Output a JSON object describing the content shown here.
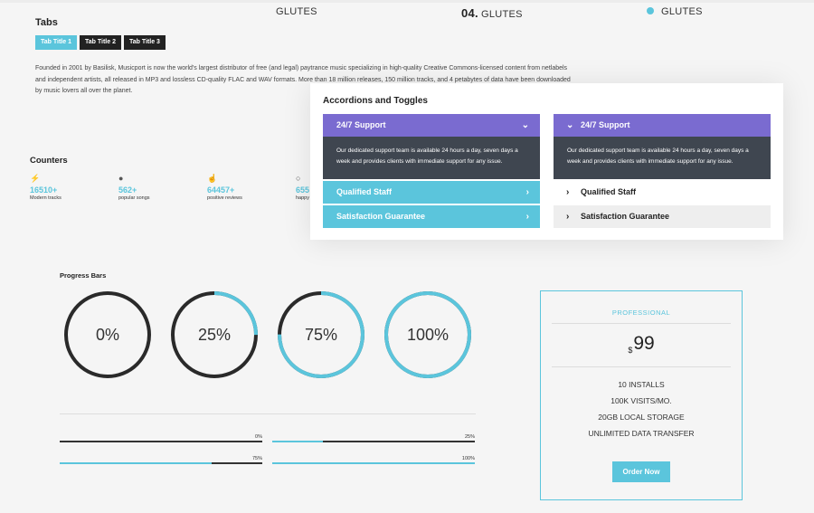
{
  "topnav": {
    "item1": "GLUTES",
    "item2_num": "04.",
    "item2": "GLUTES",
    "item3": "GLUTES"
  },
  "tabs": {
    "title": "Tabs",
    "items": [
      "Tab Title 1",
      "Tab Title 2",
      "Tab Title 3"
    ],
    "text": "Founded in 2001 by Basilisk, Musicport is now the world's largest distributor of free (and legal) paytrance music specializing in high-quality Creative Commons-licensed content from netlabels and independent artists, all released in MP3 and lossless CD-quality FLAC and WAV formats. More than 18 million releases, 150 million tracks, and 4 petabytes of data have been downloaded by music lovers all over the planet."
  },
  "counters": {
    "title": "Counters",
    "items": [
      {
        "icon": "bolt-icon",
        "value": "16510+",
        "label": "Modern tracks"
      },
      {
        "icon": "note-icon",
        "value": "562+",
        "label": "popular songs"
      },
      {
        "icon": "hand-icon",
        "value": "64457+",
        "label": "positive reviews"
      },
      {
        "icon": "bulb-icon",
        "value": "655",
        "label": "happy"
      }
    ]
  },
  "accordions": {
    "title": "Accordions and Toggles",
    "left": [
      {
        "label": "24/7 Support",
        "open": true,
        "body": "Our dedicated support team is available 24 hours a day, seven days a week and provides clients with immediate support for any issue."
      },
      {
        "label": "Qualified Staff",
        "open": false
      },
      {
        "label": "Satisfaction Guarantee",
        "open": false
      }
    ],
    "right": [
      {
        "label": "24/7 Support",
        "open": true,
        "body": "Our dedicated support team is available 24 hours a day, seven days a week and provides clients with immediate support for any issue."
      },
      {
        "label": "Qualified Staff",
        "open": false
      },
      {
        "label": "Satisfaction Guarantee",
        "open": false
      }
    ]
  },
  "progress": {
    "title": "Progress Bars",
    "circles": [
      {
        "label": "0%",
        "value": 0
      },
      {
        "label": "25%",
        "value": 25
      },
      {
        "label": "75%",
        "value": 75
      },
      {
        "label": "100%",
        "value": 100
      }
    ],
    "bars": [
      {
        "label": "0%",
        "value": 0
      },
      {
        "label": "25%",
        "value": 25
      },
      {
        "label": "75%",
        "value": 75
      },
      {
        "label": "100%",
        "value": 100
      }
    ]
  },
  "pricing": {
    "plan": "PROFESSIONAL",
    "currency": "$",
    "amount": "99",
    "features": [
      "10 INSTALLS",
      "100K VISITS/MO.",
      "20GB LOCAL STORAGE",
      "UNLIMITED DATA TRANSFER"
    ],
    "button": "Order Now"
  },
  "colors": {
    "accent": "#5bc5dc",
    "purple": "#7a6bd0",
    "dark": "#3f4650",
    "ring": "#2a2a2a"
  }
}
